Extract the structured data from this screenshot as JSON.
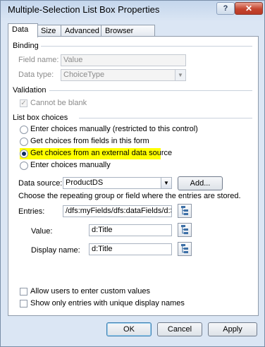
{
  "window": {
    "title": "Multiple-Selection List Box Properties",
    "help_label": "?",
    "close_label": "✕"
  },
  "tabs": [
    {
      "label": "Data",
      "active": true
    },
    {
      "label": "Size",
      "active": false
    },
    {
      "label": "Advanced",
      "active": false
    },
    {
      "label": "Browser forms",
      "active": false
    }
  ],
  "binding": {
    "section": "Binding",
    "field_name_label": "Field name:",
    "field_name_value": "Value",
    "data_type_label": "Data type:",
    "data_type_value": "ChoiceType"
  },
  "validation": {
    "section": "Validation",
    "cannot_be_blank": "Cannot be blank",
    "cannot_be_blank_checked": true
  },
  "list_box_choices": {
    "section": "List box choices",
    "options": [
      "Enter choices manually (restricted to this control)",
      "Get choices from fields in this form",
      "Get choices from an external data source",
      "Enter choices manually"
    ],
    "selected_index": 2
  },
  "data_source": {
    "label": "Data source:",
    "value": "ProductDS",
    "add_button": "Add...",
    "hint": "Choose the repeating group or field where the entries are stored.",
    "entries_label": "Entries:",
    "entries_value": "/dfs:myFields/dfs:dataFields/d:Sha",
    "value_label": "Value:",
    "value_value": "d:Title",
    "display_name_label": "Display name:",
    "display_name_value": "d:Title"
  },
  "options": {
    "allow_custom": "Allow users to enter custom values",
    "unique_names": "Show only entries with unique display names"
  },
  "footer": {
    "ok": "OK",
    "cancel": "Cancel",
    "apply": "Apply"
  },
  "colors": {
    "highlight": "#ffff00",
    "accent": "#3c7fb1"
  }
}
